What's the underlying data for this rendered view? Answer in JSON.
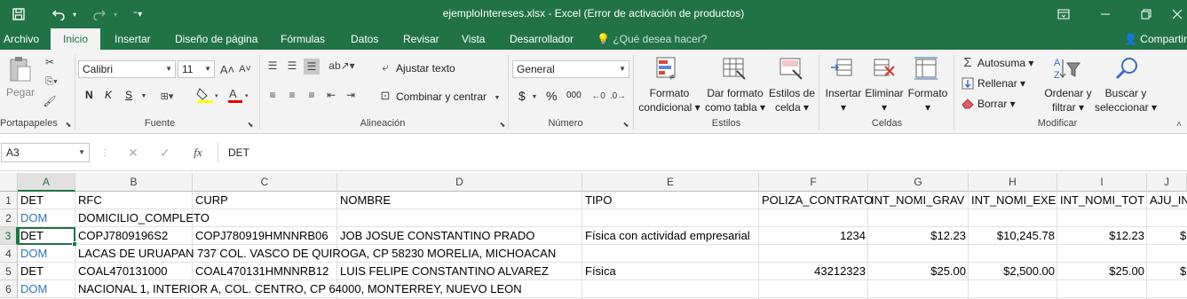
{
  "titlebar": {
    "title": "ejemploIntereses.xlsx - Excel (Error de activación de productos)",
    "save_icon": "save-icon",
    "undo_icon": "undo-icon",
    "redo_icon": "redo-icon",
    "customize_icon": "customize-qat-icon",
    "ribbon_display_icon": "ribbon-display-icon",
    "minimize_icon": "minimize-icon",
    "restore_icon": "restore-icon",
    "close_icon": "close-icon"
  },
  "tabs": {
    "items": [
      "Archivo",
      "Inicio",
      "Insertar",
      "Diseño de página",
      "Fórmulas",
      "Datos",
      "Revisar",
      "Vista",
      "Desarrollador"
    ],
    "active": "Inicio",
    "tell_me": "¿Qué desea hacer?",
    "share": "Compartir"
  },
  "ribbon": {
    "clipboard": {
      "paste": "Pegar",
      "label": "Portapapeles"
    },
    "font": {
      "name": "Calibri",
      "size": "11",
      "bold": "N",
      "italic": "K",
      "underline": "S",
      "label": "Fuente"
    },
    "alignment": {
      "wrap": "Ajustar texto",
      "merge": "Combinar y centrar",
      "label": "Alineación"
    },
    "number": {
      "format": "General",
      "currency": "$",
      "percent": "%",
      "thousands": "000",
      "label": "Número"
    },
    "styles": {
      "conditional_1": "Formato",
      "conditional_2": "condicional",
      "table_1": "Dar formato",
      "table_2": "como tabla",
      "cell_1": "Estilos de",
      "cell_2": "celda",
      "label": "Estilos"
    },
    "cells": {
      "insert": "Insertar",
      "delete": "Eliminar",
      "format": "Formato",
      "label": "Celdas"
    },
    "editing": {
      "autosum": "Autosuma",
      "fill": "Rellenar",
      "clear": "Borrar",
      "sort_1": "Ordenar y",
      "sort_2": "filtrar",
      "find_1": "Buscar y",
      "find_2": "seleccionar",
      "label": "Modificar"
    }
  },
  "formula_bar": {
    "name_box": "A3",
    "fx": "fx",
    "value": "DET"
  },
  "grid": {
    "columns": [
      "A",
      "B",
      "C",
      "D",
      "E",
      "F",
      "G",
      "H",
      "I",
      "J"
    ],
    "selected_column": "A",
    "selected_row": "3",
    "rows": [
      {
        "num": "1",
        "cells": [
          "DET",
          "RFC",
          "CURP",
          "NOMBRE",
          "TIPO",
          "POLIZA_CONTRATO",
          "INT_NOMI_GRAV",
          "INT_NOMI_EXE",
          "INT_NOMI_TOT",
          "AJU_IN"
        ]
      },
      {
        "num": "2",
        "cells": [
          "DOM",
          "DOMICILIO_COMPLETO",
          "",
          "",
          "",
          "",
          "",
          "",
          "",
          ""
        ]
      },
      {
        "num": "3",
        "cells": [
          "DET",
          "COPJ7809196S2",
          "COPJ780919HMNNRB06",
          "JOB JOSUE CONSTANTINO PRADO",
          "Física con actividad empresarial",
          "1234",
          "$12.23",
          "$10,245.78",
          "$12.23",
          "$"
        ]
      },
      {
        "num": "4",
        "cells": [
          "DOM",
          "LACAS DE URUAPAN 737 COL. VASCO DE QUIROGA, CP 58230 MORELIA, MICHOACAN",
          "",
          "",
          "",
          "",
          "",
          "",
          "",
          ""
        ]
      },
      {
        "num": "5",
        "cells": [
          "DET",
          "COAL470131000",
          "COAL470131HMNNRB12",
          "LUIS FELIPE CONSTANTINO ALVAREZ",
          "Física",
          "43212323",
          "$25.00",
          "$2,500.00",
          "$25.00",
          "$"
        ]
      },
      {
        "num": "6",
        "cells": [
          "DOM",
          "NACIONAL 1, INTERIOR A, COL. CENTRO, CP 64000, MONTERREY, NUEVO LEON",
          "",
          "",
          "",
          "",
          "",
          "",
          "",
          ""
        ]
      }
    ]
  }
}
